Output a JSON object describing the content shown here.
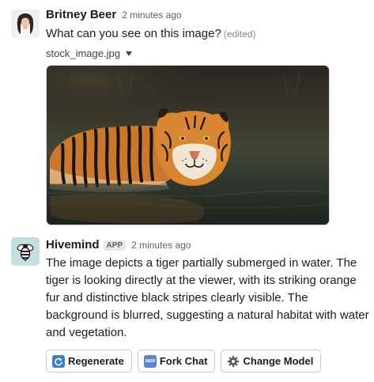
{
  "messages": {
    "user": {
      "name": "Britney Beer",
      "time": "2 minutes ago",
      "text": "What can you see on this image?",
      "edited": "(edited)",
      "attachment": {
        "file_name": "stock_image.jpg",
        "image_icon": "tiger-photo"
      }
    },
    "bot": {
      "name": "Hivemind",
      "badge": "APP",
      "time": "2 minutes ago",
      "text": "The image depicts a tiger partially submerged in water. The tiger is looking directly at the viewer, with its striking orange fur and distinctive black stripes clearly visible. The background is blurred, suggesting a natural habitat with water and vegetation.",
      "avatar_icon": "bee-icon"
    }
  },
  "actions": [
    {
      "label": "Regenerate",
      "icon": "regenerate-icon"
    },
    {
      "label": "Fork Chat",
      "icon": "new-icon",
      "icon_text": "NEW"
    },
    {
      "label": "Change Model",
      "icon": "gear-icon"
    }
  ],
  "colors": {
    "text": "#1d1c1d",
    "muted": "#616061",
    "bot_avatar_bg": "#c6dde2",
    "button_border": "#c9c9c9"
  }
}
